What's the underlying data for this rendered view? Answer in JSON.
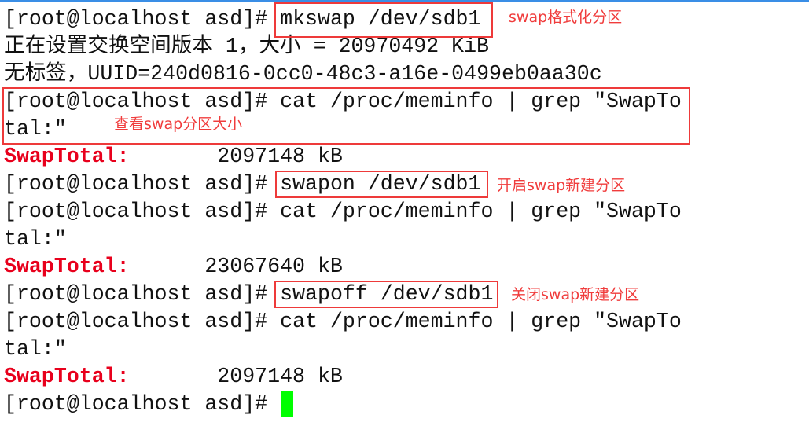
{
  "terminal": {
    "prompt": "[root@localhost asd]# ",
    "lines": [
      {
        "type": "cmd",
        "text": "mkswap /dev/sdb1"
      },
      {
        "type": "out",
        "text": "正在设置交换空间版本 1，大小 = 20970492 KiB"
      },
      {
        "type": "out",
        "text": "无标签，UUID=240d0816-0cc0-48c3-a16e-0499eb0aa30c"
      },
      {
        "type": "cmd",
        "text": "cat /proc/meminfo | grep \"SwapTo"
      },
      {
        "type": "out",
        "text": "tal:\""
      },
      {
        "type": "swap",
        "label": "SwapTotal:",
        "value": "       2097148 kB"
      },
      {
        "type": "cmd",
        "text": "swapon /dev/sdb1"
      },
      {
        "type": "cmd",
        "text": "cat /proc/meminfo | grep \"SwapTo"
      },
      {
        "type": "out",
        "text": "tal:\""
      },
      {
        "type": "swap",
        "label": "SwapTotal:",
        "value": "      23067640 kB"
      },
      {
        "type": "cmd",
        "text": "swapoff /dev/sdb1"
      },
      {
        "type": "cmd",
        "text": "cat /proc/meminfo | grep \"SwapTo"
      },
      {
        "type": "out",
        "text": "tal:\""
      },
      {
        "type": "swap",
        "label": "SwapTotal:",
        "value": "       2097148 kB"
      },
      {
        "type": "cmd",
        "text": ""
      }
    ],
    "cursor_color": "#00ff00",
    "highlight_color": "#e8001c"
  },
  "annotations": {
    "mkswap": "swap格式化分区",
    "meminfo": "查看swap分区大小",
    "swapon": "开启swap新建分区",
    "swapoff": "关闭swap新建分区"
  }
}
